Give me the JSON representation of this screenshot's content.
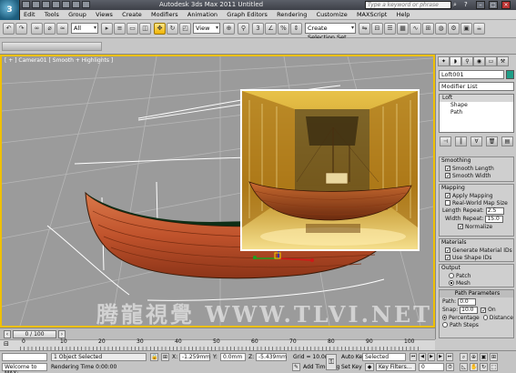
{
  "window": {
    "app_title": "Autodesk 3ds Max  2011      Untitled",
    "search_placeholder": "Type a keyword or phrase",
    "logo_text": "3"
  },
  "menu": [
    "Edit",
    "Tools",
    "Group",
    "Views",
    "Create",
    "Modifiers",
    "Animation",
    "Graph Editors",
    "Rendering",
    "Customize",
    "MAXScript",
    "Help"
  ],
  "toolbar": {
    "selection_filter": "All",
    "reference_coord": "View",
    "named_selection": "Create Selection Set"
  },
  "viewport": {
    "label": "[ + ] Camera01 [ Smooth + Highlights ]",
    "watermark": "腾龍視覺 WWW.TLVI.NET"
  },
  "command_panel": {
    "object_name": "Loft001",
    "modifier_list": "Modifier List",
    "stack": [
      "Loft",
      "Shape",
      "Path"
    ],
    "smoothing": {
      "title": "Smoothing",
      "smooth_length": "Smooth Length",
      "smooth_width": "Smooth Width"
    },
    "mapping": {
      "title": "Mapping",
      "apply_mapping": "Apply Mapping",
      "real_world": "Real-World Map Size",
      "length_repeat_label": "Length Repeat:",
      "length_repeat": "2.5",
      "width_repeat_label": "Width Repeat:",
      "width_repeat": "15.0",
      "normalize": "Normalize"
    },
    "materials": {
      "title": "Materials",
      "generate_ids": "Generate Material IDs",
      "use_shape_ids": "Use Shape IDs"
    },
    "output": {
      "title": "Output",
      "patch": "Patch",
      "mesh": "Mesh"
    },
    "path_parameters": {
      "title": "Path Parameters",
      "path_label": "Path:",
      "path": "0.0",
      "snap_label": "Snap:",
      "snap": "10.0",
      "on": "On",
      "percentage": "Percentage",
      "distance": "Distance",
      "path_steps": "Path Steps"
    }
  },
  "timeline": {
    "frame": "0 / 100",
    "ticks": [
      "0",
      "10",
      "20",
      "30",
      "40",
      "50",
      "60",
      "70",
      "80",
      "90",
      "100"
    ]
  },
  "status": {
    "maxscript_listener": "Welcome to MAX:",
    "selected": "1 Object Selected",
    "rendering_time": "Rendering Time  0:00:00",
    "x_label": "X:",
    "x": "-1.259mm",
    "y_label": "Y:",
    "y": "0.0mm",
    "z_label": "Z:",
    "z": "-5.439mm",
    "grid": "Grid = 10.0mm",
    "add_time_tag": "Add Time Tag",
    "auto_key": "Auto Key",
    "key_mode": "Selected",
    "set_key": "Set Key",
    "key_filters": "Key Filters...",
    "current_frame": "0"
  },
  "colors": {
    "viewport_border": "#f0c000",
    "viewport_bg": "#9b9b9b",
    "hull": "#c8643a"
  }
}
